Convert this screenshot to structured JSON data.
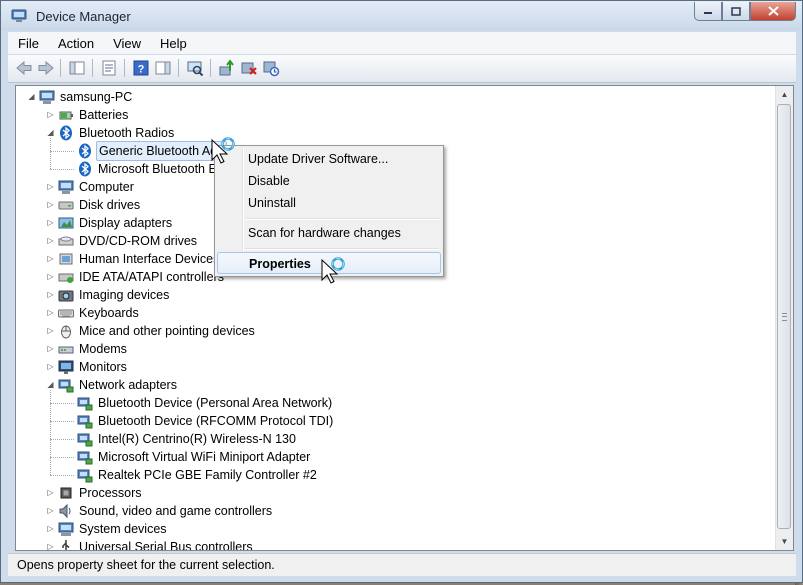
{
  "window": {
    "title": "Device Manager"
  },
  "menu": [
    "File",
    "Action",
    "View",
    "Help"
  ],
  "toolbar": {
    "buttons": [
      "back-arrow-icon",
      "forward-arrow-icon",
      "show-hide-tree-icon",
      "properties-icon",
      "help-icon",
      "action-pane-icon",
      "scan-hardware-icon",
      "update-driver-icon",
      "uninstall-icon",
      "enable-device-icon"
    ]
  },
  "tree": {
    "root": "samsung-PC",
    "items": [
      {
        "label": "Batteries",
        "icon": "battery-icon",
        "level": 1,
        "expand": "collapsed"
      },
      {
        "label": "Bluetooth Radios",
        "icon": "bluetooth-icon",
        "level": 1,
        "expand": "expanded"
      },
      {
        "label": "Generic Bluetooth Ada",
        "icon": "bluetooth-icon",
        "level": 2,
        "expand": "none",
        "selected": true
      },
      {
        "label": "Microsoft Bluetooth E",
        "icon": "bluetooth-icon",
        "level": 2,
        "expand": "none"
      },
      {
        "label": "Computer",
        "icon": "computer-icon",
        "level": 1,
        "expand": "collapsed"
      },
      {
        "label": "Disk drives",
        "icon": "disk-drive-icon",
        "level": 1,
        "expand": "collapsed"
      },
      {
        "label": "Display adapters",
        "icon": "display-adapter-icon",
        "level": 1,
        "expand": "collapsed"
      },
      {
        "label": "DVD/CD-ROM drives",
        "icon": "dvd-drive-icon",
        "level": 1,
        "expand": "collapsed"
      },
      {
        "label": "Human Interface Devices",
        "icon": "hid-icon",
        "level": 1,
        "expand": "collapsed"
      },
      {
        "label": "IDE ATA/ATAPI controllers",
        "icon": "ide-controller-icon",
        "level": 1,
        "expand": "collapsed"
      },
      {
        "label": "Imaging devices",
        "icon": "camera-icon",
        "level": 1,
        "expand": "collapsed"
      },
      {
        "label": "Keyboards",
        "icon": "keyboard-icon",
        "level": 1,
        "expand": "collapsed"
      },
      {
        "label": "Mice and other pointing devices",
        "icon": "mouse-icon",
        "level": 1,
        "expand": "collapsed"
      },
      {
        "label": "Modems",
        "icon": "modem-icon",
        "level": 1,
        "expand": "collapsed"
      },
      {
        "label": "Monitors",
        "icon": "monitor-icon",
        "level": 1,
        "expand": "collapsed"
      },
      {
        "label": "Network adapters",
        "icon": "network-adapter-icon",
        "level": 1,
        "expand": "expanded"
      },
      {
        "label": "Bluetooth Device (Personal Area Network)",
        "icon": "network-adapter-icon",
        "level": 2,
        "expand": "none"
      },
      {
        "label": "Bluetooth Device (RFCOMM Protocol TDI)",
        "icon": "network-adapter-icon",
        "level": 2,
        "expand": "none"
      },
      {
        "label": "Intel(R) Centrino(R) Wireless-N 130",
        "icon": "network-adapter-icon",
        "level": 2,
        "expand": "none"
      },
      {
        "label": "Microsoft Virtual WiFi Miniport Adapter",
        "icon": "network-adapter-icon",
        "level": 2,
        "expand": "none"
      },
      {
        "label": "Realtek PCIe GBE Family Controller #2",
        "icon": "network-adapter-icon",
        "level": 2,
        "expand": "none"
      },
      {
        "label": "Processors",
        "icon": "processor-icon",
        "level": 1,
        "expand": "collapsed"
      },
      {
        "label": "Sound, video and game controllers",
        "icon": "sound-icon",
        "level": 1,
        "expand": "collapsed"
      },
      {
        "label": "System devices",
        "icon": "system-device-icon",
        "level": 1,
        "expand": "collapsed"
      },
      {
        "label": "Universal Serial Bus controllers",
        "icon": "usb-icon",
        "level": 1,
        "expand": "collapsed"
      }
    ]
  },
  "context_menu": {
    "items": [
      "Update Driver Software...",
      "Disable",
      "Uninstall",
      "Scan for hardware changes",
      "Properties"
    ],
    "hovered": "Properties"
  },
  "status": {
    "text": "Opens property sheet for the current selection."
  },
  "colors": {
    "bluetooth": "#1a66c4",
    "selection": "#e2eefb",
    "close_button": "#c4402e"
  }
}
